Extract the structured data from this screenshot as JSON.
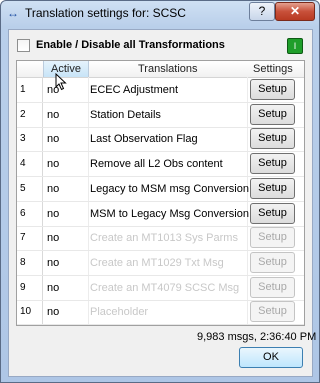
{
  "window": {
    "title": "Translation settings for: SCSC",
    "help_label": "?",
    "close_label": "✕"
  },
  "master_toggle": {
    "label": "Enable / Disable all Transformations",
    "checked": false
  },
  "status_led": {
    "label": "I",
    "color": "#1f9e2a"
  },
  "table": {
    "headers": {
      "active": "Active",
      "translations": "Translations",
      "settings": "Settings"
    },
    "rows": [
      {
        "num": "1",
        "active": "no",
        "translation": "ECEC Adjustment",
        "setup": "Setup",
        "enabled": true
      },
      {
        "num": "2",
        "active": "no",
        "translation": "Station Details",
        "setup": "Setup",
        "enabled": true
      },
      {
        "num": "3",
        "active": "no",
        "translation": "Last Observation Flag",
        "setup": "Setup",
        "enabled": true
      },
      {
        "num": "4",
        "active": "no",
        "translation": "Remove all L2 Obs content",
        "setup": "Setup",
        "enabled": true
      },
      {
        "num": "5",
        "active": "no",
        "translation": "Legacy to MSM msg Conversion",
        "setup": "Setup",
        "enabled": true
      },
      {
        "num": "6",
        "active": "no",
        "translation": "MSM to Legacy Msg Conversion",
        "setup": "Setup",
        "enabled": true
      },
      {
        "num": "7",
        "active": "no",
        "translation": "Create an MT1013 Sys Parms",
        "setup": "Setup",
        "enabled": false
      },
      {
        "num": "8",
        "active": "no",
        "translation": "Create an MT1029 Txt Msg",
        "setup": "Setup",
        "enabled": false
      },
      {
        "num": "9",
        "active": "no",
        "translation": "Create an MT4079 SCSC Msg",
        "setup": "Setup",
        "enabled": false
      },
      {
        "num": "10",
        "active": "no",
        "translation": "Placeholder",
        "setup": "Setup",
        "enabled": false
      }
    ]
  },
  "status": {
    "text": "9,983 msgs,   2:36:40 PM"
  },
  "ok_button": {
    "label": "OK"
  }
}
